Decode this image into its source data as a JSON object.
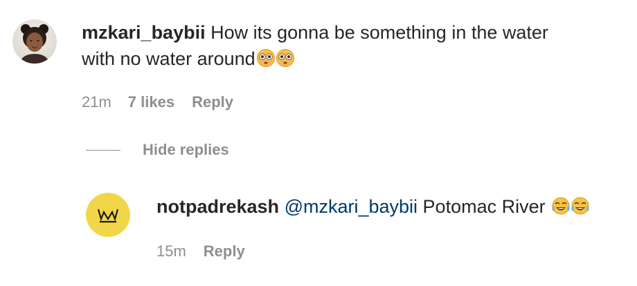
{
  "comment": {
    "username": "mzkari_baybii",
    "text_line1": "How its gonna be something in the water",
    "text_line2": "with no water around",
    "emoji_icons": [
      "flushed-face-icon",
      "flushed-face-icon"
    ],
    "time": "21m",
    "likes": "7 likes",
    "reply_label": "Reply"
  },
  "replies_toggle": {
    "label": "Hide replies"
  },
  "reply": {
    "username": "notpadrekash",
    "mention": "@mzkari_baybii",
    "text": "Potomac River",
    "emoji_icons": [
      "tears-of-joy-icon",
      "tears-of-joy-icon"
    ],
    "time": "15m",
    "reply_label": "Reply"
  },
  "colors": {
    "text": "#262626",
    "secondary": "#8e8e8e",
    "mention": "#00376b",
    "crown_avatar_bg": "#f2d649"
  }
}
